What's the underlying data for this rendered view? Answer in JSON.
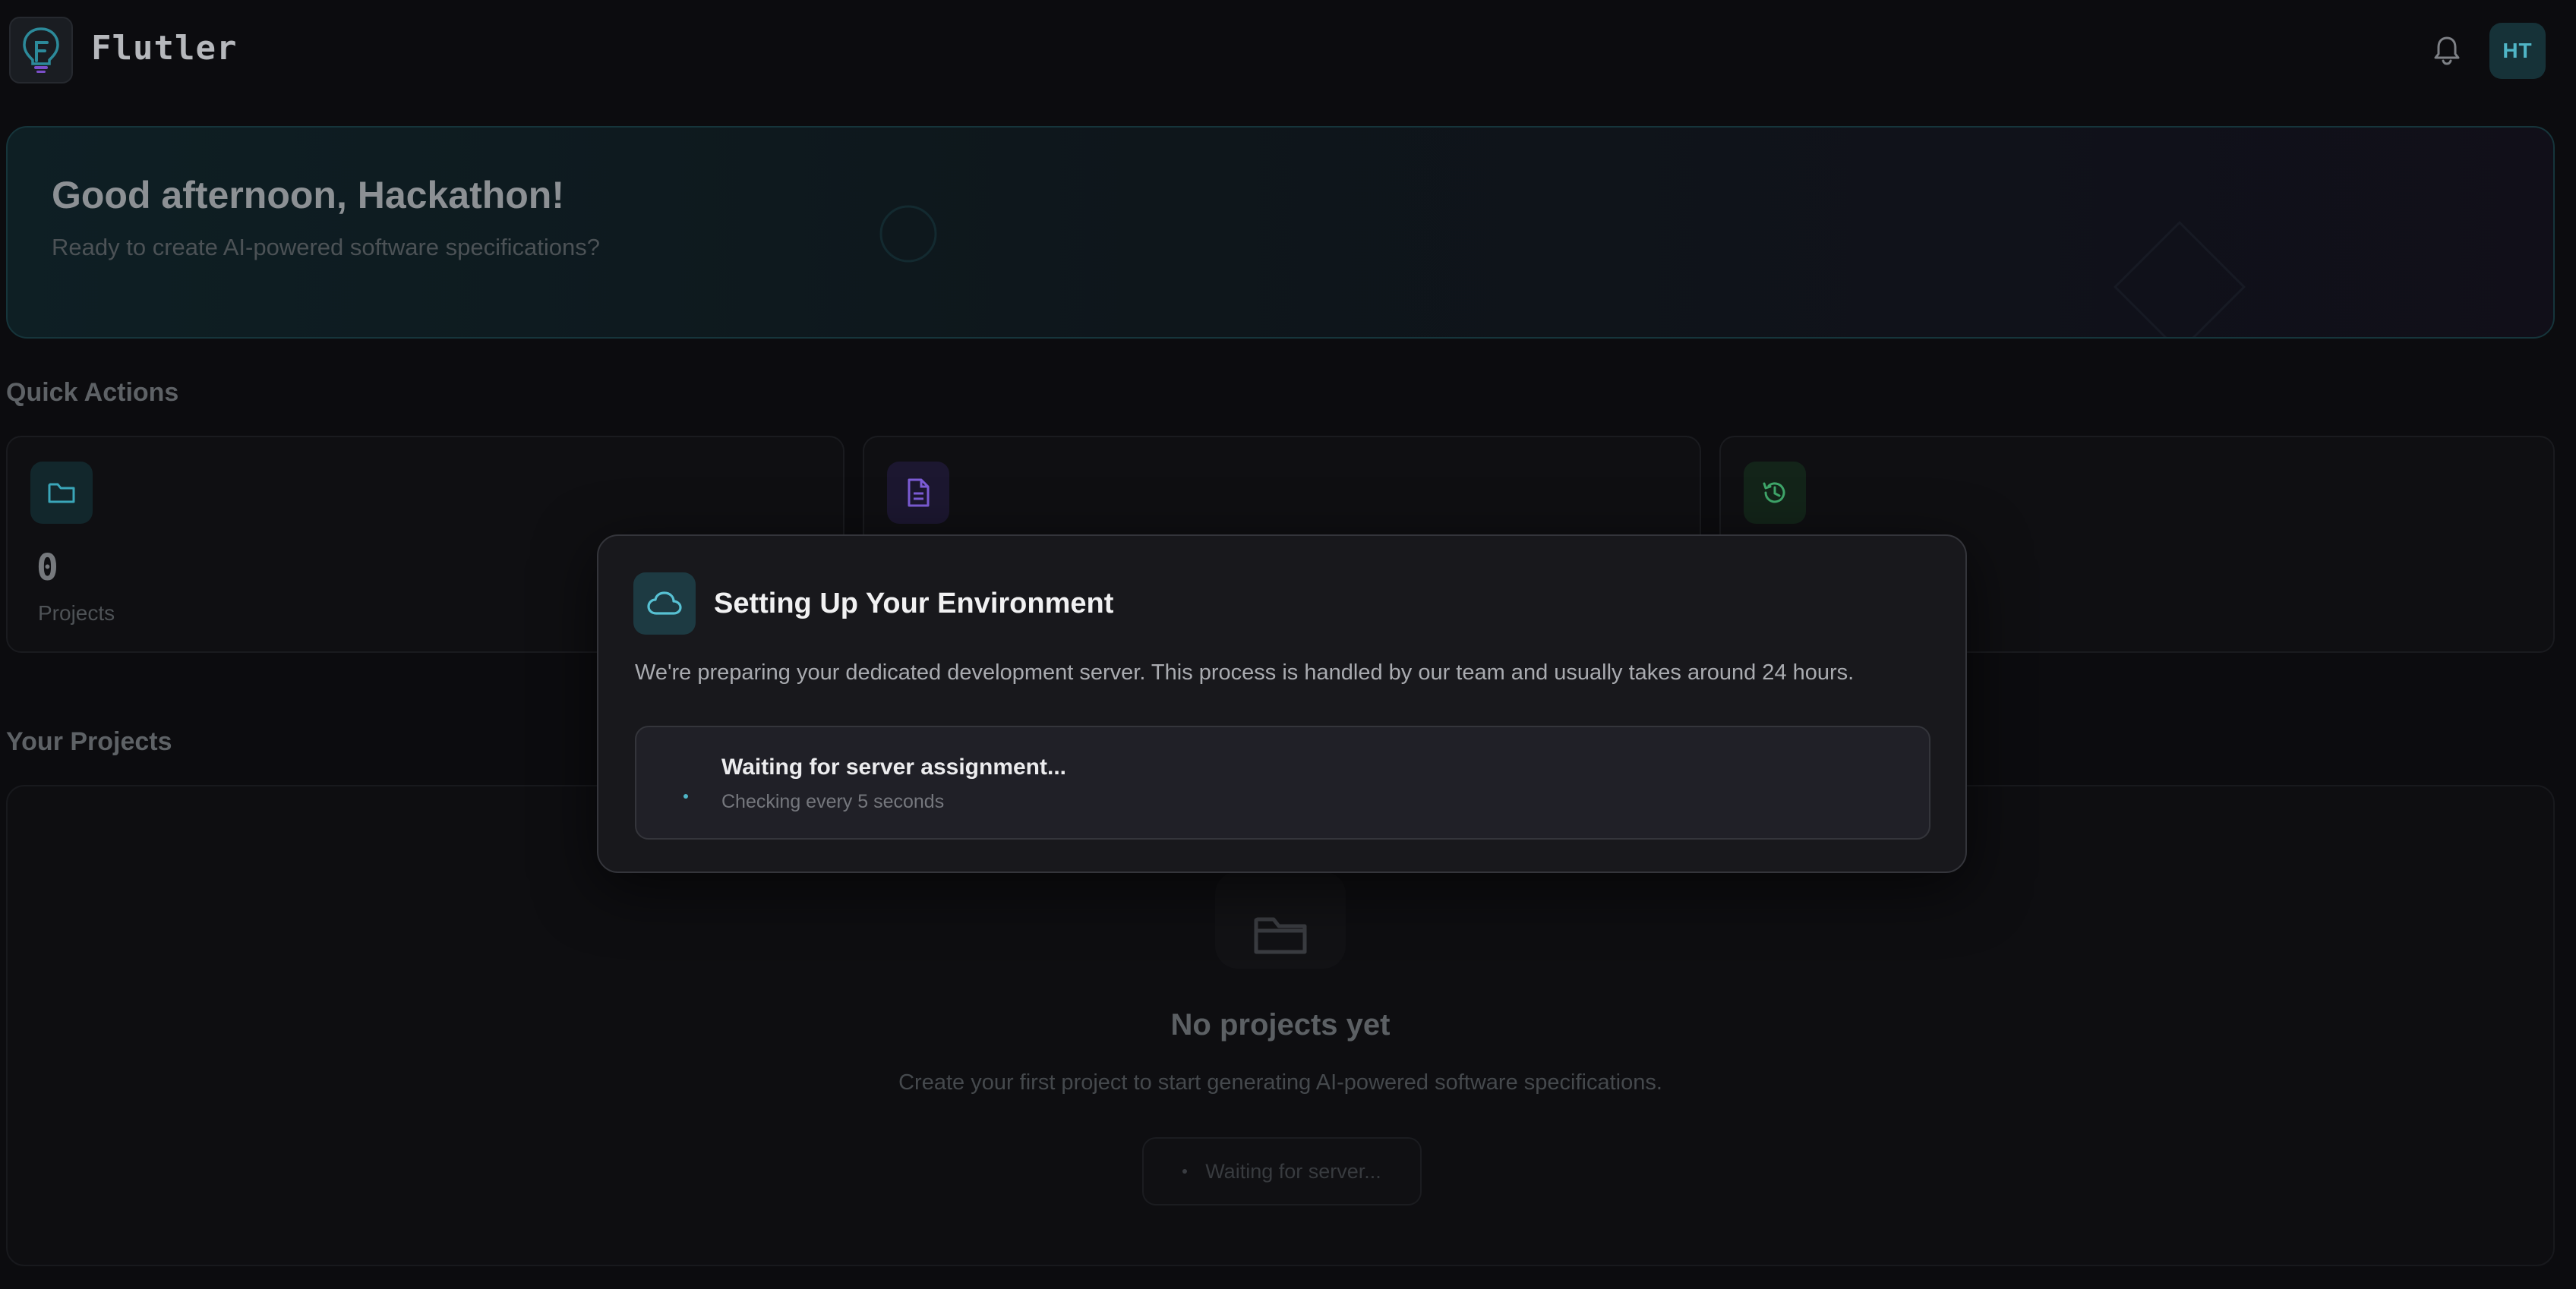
{
  "header": {
    "app_name": "Flutler",
    "avatar_initials": "HT",
    "icons": {
      "logo": "bulb-logo-icon",
      "notifications": "bell-icon"
    }
  },
  "banner": {
    "title": "Good afternoon, Hackathon!",
    "subtitle": "Ready to create AI-powered software specifications?"
  },
  "quick_actions": {
    "title": "Quick Actions",
    "cards": [
      {
        "icon": "folder-icon",
        "count": "0",
        "label": "Projects",
        "accent": "#3aa6b9"
      },
      {
        "icon": "document-icon",
        "count": "",
        "label": "",
        "accent": "#7c5cd6"
      },
      {
        "icon": "history-icon",
        "count": "",
        "label": "",
        "accent": "#3fa66a"
      }
    ]
  },
  "projects": {
    "title": "Your Projects",
    "empty_icon": "folder-icon",
    "empty_title": "No projects yet",
    "empty_desc": "Create your first project to start generating AI-powered software specifications.",
    "waiting_button": "Waiting for server..."
  },
  "modal": {
    "icon": "cloud-icon",
    "title": "Setting Up Your Environment",
    "description": "We're preparing your dedicated development server. This process is handled by our team and usually takes around 24 hours.",
    "status_title": "Waiting for server assignment...",
    "status_sub": "Checking every 5 seconds"
  },
  "colors": {
    "background": "#0c0c0f",
    "accent": "#4fb5c6",
    "modal_bg": "#18181c"
  }
}
